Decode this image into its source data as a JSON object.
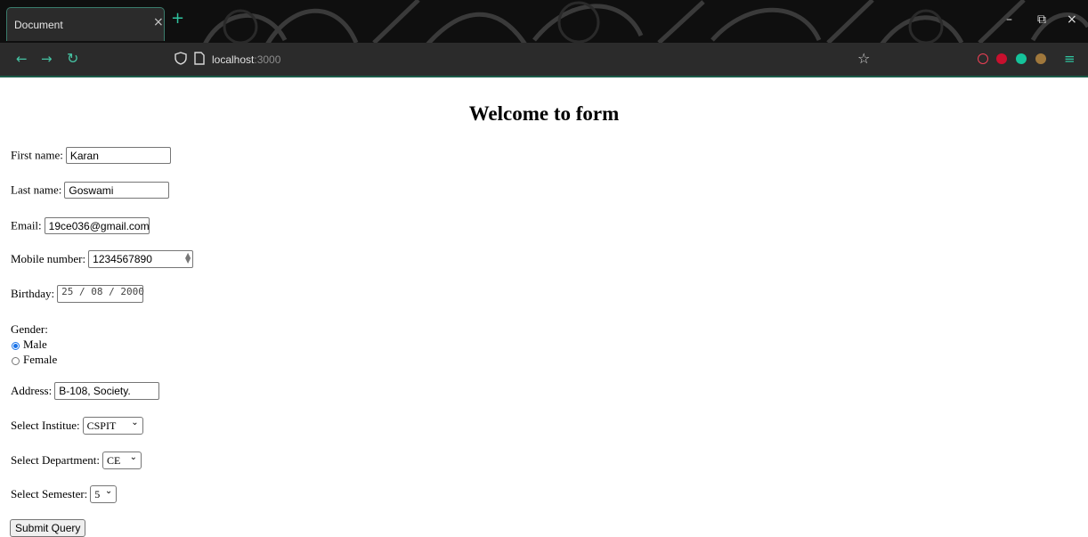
{
  "browser": {
    "tab_title": "Document",
    "tab_close": "×",
    "new_tab": "+",
    "url_host": "localhost",
    "url_port": ":3000",
    "icons": [
      "back-icon",
      "forward-icon",
      "reload-icon",
      "shield-icon",
      "page-icon",
      "star-icon",
      "pocket-icon",
      "ublock-icon",
      "grammarly-icon",
      "extension-icon",
      "menu-icon"
    ],
    "window_controls": {
      "minimize": "–",
      "restore": "⧉",
      "close": "×"
    },
    "accent": "#2fc39f"
  },
  "page": {
    "heading": "Welcome to form",
    "first_name": {
      "label": "First name:",
      "value": "Karan"
    },
    "last_name": {
      "label": "Last name:",
      "value": "Goswami"
    },
    "email": {
      "label": "Email:",
      "value": "19ce036@gmail.com"
    },
    "mobile": {
      "label": "Mobile number:",
      "value": "1234567890"
    },
    "birthday": {
      "label": "Birthday:",
      "value": "25 / 08 / 2000"
    },
    "gender": {
      "label": "Gender:",
      "options": [
        "Male",
        "Female"
      ],
      "selected": "Male"
    },
    "address": {
      "label": "Address:",
      "value": "B-108, Society."
    },
    "institute": {
      "label": "Select Institue:",
      "value": "CSPIT"
    },
    "department": {
      "label": "Select Department:",
      "value": "CE"
    },
    "semester": {
      "label": "Select Semester:",
      "value": "5"
    },
    "submit": "Submit Query"
  }
}
